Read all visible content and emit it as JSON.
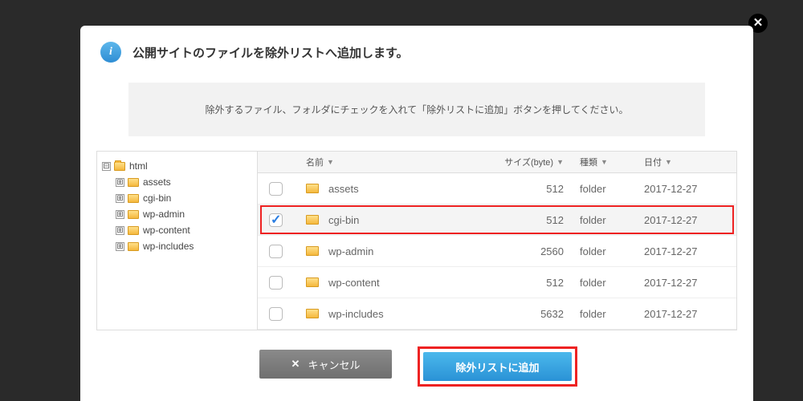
{
  "title": "公開サイトのファイルを除外リストへ追加します。",
  "instruction": "除外するファイル、フォルダにチェックを入れて「除外リストに追加」ボタンを押してください。",
  "tree": {
    "root": {
      "name": "html",
      "expander": "⊟"
    },
    "children": [
      {
        "name": "assets",
        "expander": "⊞"
      },
      {
        "name": "cgi-bin",
        "expander": "⊞"
      },
      {
        "name": "wp-admin",
        "expander": "⊞"
      },
      {
        "name": "wp-content",
        "expander": "⊞"
      },
      {
        "name": "wp-includes",
        "expander": "⊞"
      }
    ]
  },
  "columns": {
    "name": "名前",
    "size": "サイズ(byte)",
    "type": "種類",
    "date": "日付"
  },
  "rows": [
    {
      "name": "assets",
      "size": "512",
      "type": "folder",
      "date": "2017-12-27",
      "checked": false,
      "highlighted": false
    },
    {
      "name": "cgi-bin",
      "size": "512",
      "type": "folder",
      "date": "2017-12-27",
      "checked": true,
      "highlighted": true
    },
    {
      "name": "wp-admin",
      "size": "2560",
      "type": "folder",
      "date": "2017-12-27",
      "checked": false,
      "highlighted": false
    },
    {
      "name": "wp-content",
      "size": "512",
      "type": "folder",
      "date": "2017-12-27",
      "checked": false,
      "highlighted": false
    },
    {
      "name": "wp-includes",
      "size": "5632",
      "type": "folder",
      "date": "2017-12-27",
      "checked": false,
      "highlighted": false
    }
  ],
  "buttons": {
    "cancel": "キャンセル",
    "primary": "除外リストに追加"
  }
}
